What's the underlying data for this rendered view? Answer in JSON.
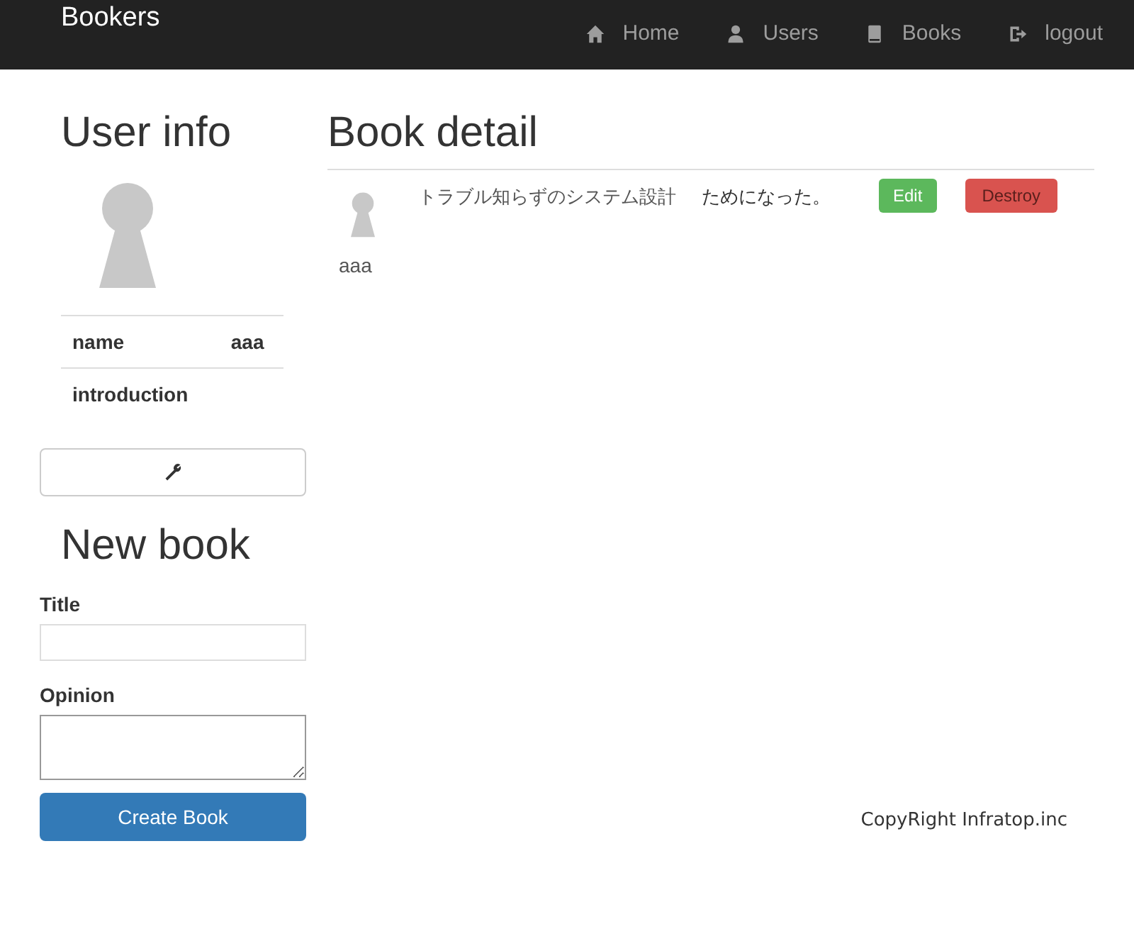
{
  "navbar": {
    "brand": "Bookers",
    "links": [
      {
        "kind": "home",
        "label": "Home"
      },
      {
        "kind": "user",
        "label": "Users"
      },
      {
        "kind": "book",
        "label": "Books"
      },
      {
        "kind": "logout",
        "label": "logout"
      }
    ]
  },
  "user_info": {
    "heading": "User info",
    "rows": [
      {
        "label": "name",
        "value": "aaa"
      },
      {
        "label": "introduction",
        "value": ""
      }
    ]
  },
  "new_book": {
    "heading": "New book",
    "title_label": "Title",
    "opinion_label": "Opinion",
    "submit": "Create Book"
  },
  "book_detail": {
    "heading": "Book detail",
    "title": "トラブル知らずのシステム設計",
    "opinion": "ためになった。",
    "edit": "Edit",
    "destroy": "Destroy",
    "user": "aaa"
  },
  "footer": "CopyRight Infratop.inc"
}
